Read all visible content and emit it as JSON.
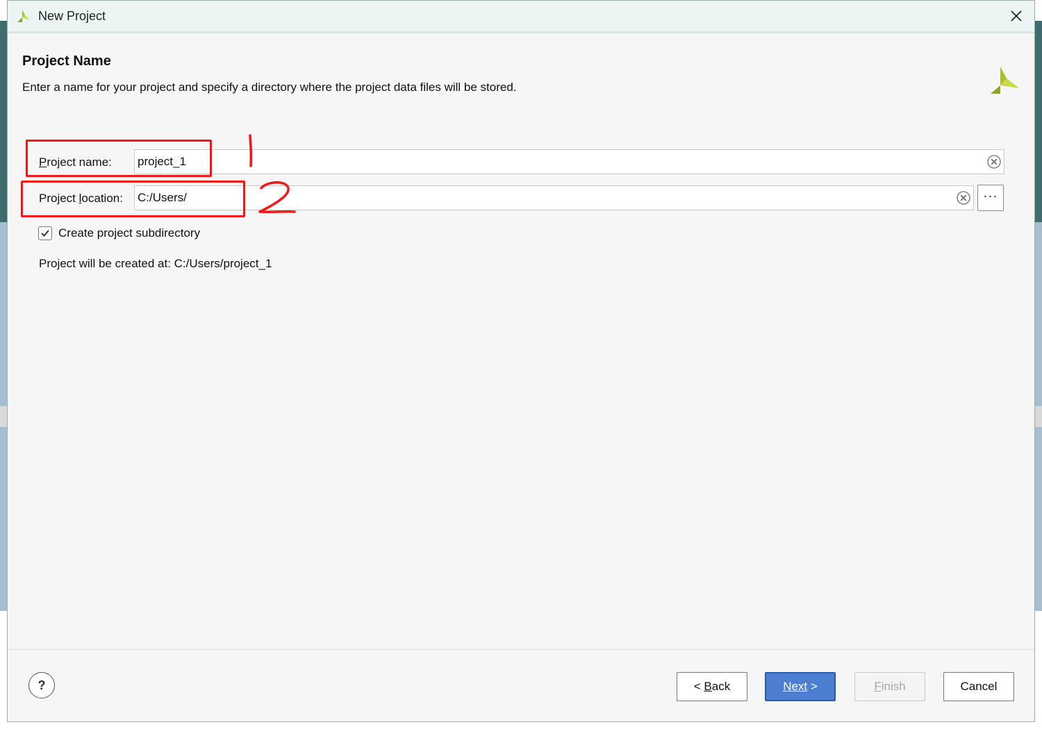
{
  "window": {
    "title": "New Project"
  },
  "header": {
    "title": "Project Name",
    "description": "Enter a name for your project and specify a directory where the project data files will be stored."
  },
  "form": {
    "project_name": {
      "label_mnemonic": "P",
      "label_rest": "roject name:",
      "value": "project_1"
    },
    "project_location": {
      "label_before": "Project ",
      "label_mnemonic": "l",
      "label_after": "ocation:",
      "value": "C:/Users/",
      "browse_label": "···"
    },
    "create_subdirectory": {
      "label": "Create project subdirectory",
      "checked": true
    },
    "created_at": "Project will be created at: C:/Users/project_1"
  },
  "footer": {
    "help_label": "?",
    "back": {
      "prefix": "< ",
      "mnemonic": "B",
      "rest": "ack"
    },
    "next": {
      "mnemonic": "Next",
      "suffix": " >"
    },
    "finish": {
      "mnemonic": "F",
      "rest": "inish"
    },
    "cancel": "Cancel"
  },
  "annotations": {
    "mark_1": "1",
    "mark_2": "2"
  },
  "colors": {
    "annotation": "#f01818",
    "primary_button": "#4d7fd0",
    "logo_green": "#8aa823",
    "logo_yellow": "#c7d84a"
  }
}
